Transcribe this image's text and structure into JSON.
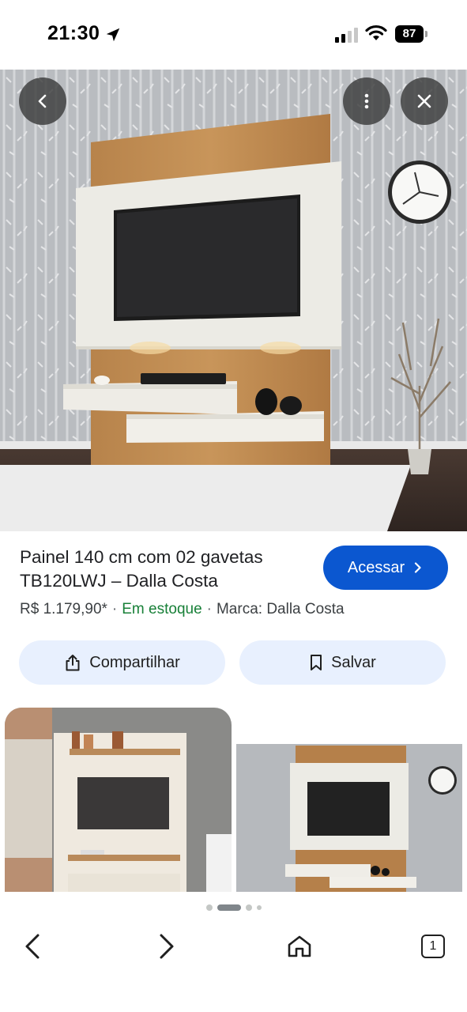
{
  "status_bar": {
    "time": "21:30",
    "battery": "87"
  },
  "hero": {
    "icons": [
      "back-icon",
      "more-vert-icon",
      "close-icon"
    ]
  },
  "product": {
    "title": "Painel 140 cm com 02 gavetas TB120LWJ – Dalla Costa",
    "price": "R$ 1.179,90*",
    "stock": "Em estoque",
    "brand": "Marca: Dalla Costa",
    "access_label": "Acessar"
  },
  "actions": {
    "share_label": "Compartilhar",
    "save_label": "Salvar"
  },
  "pager": {
    "pages": 4,
    "active": 2
  },
  "bottom_nav": {
    "tab_count": "1"
  },
  "colors": {
    "accent": "#0b57d0",
    "pill_bg": "#e8f0fe",
    "stock_green": "#188038"
  }
}
